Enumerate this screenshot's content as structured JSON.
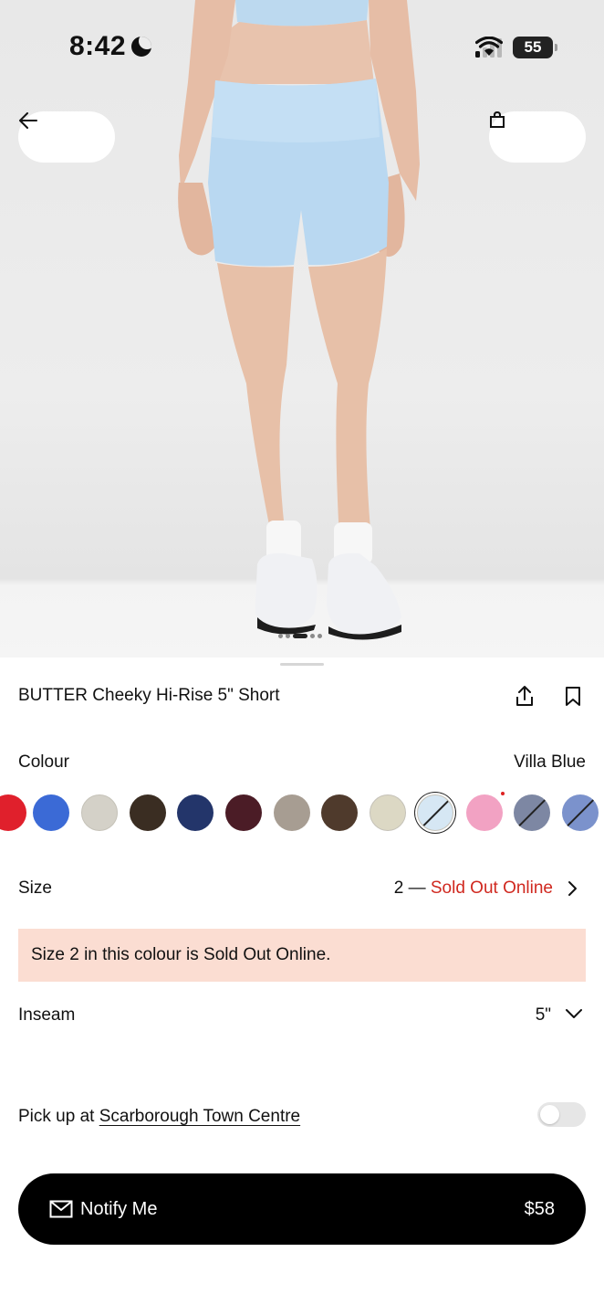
{
  "status_bar": {
    "time": "8:42",
    "battery": "55"
  },
  "product": {
    "title": "BUTTER Cheeky Hi-Rise 5\" Short",
    "colour_label": "Colour",
    "colour_value": "Villa Blue",
    "size_label": "Size",
    "size_value": "2 — ",
    "size_status": "Sold Out Online",
    "alert": "Size  2 in this colour is Sold Out Online.",
    "inseam_label": "Inseam",
    "inseam_value": "5\"",
    "pickup_prefix": "Pick up at ",
    "pickup_store": "Scarborough Town Centre",
    "notify_label": "Notify Me",
    "price": "$58"
  },
  "swatches": [
    {
      "color": "#e0202c",
      "crossed": false,
      "selected": false
    },
    {
      "color": "#3b6ad6",
      "crossed": false,
      "selected": false
    },
    {
      "color": "#d4d1c8",
      "crossed": false,
      "selected": false
    },
    {
      "color": "#3a2d22",
      "crossed": false,
      "selected": false
    },
    {
      "color": "#23356a",
      "crossed": false,
      "selected": false
    },
    {
      "color": "#4b1c26",
      "crossed": false,
      "selected": false
    },
    {
      "color": "#a79d92",
      "crossed": false,
      "selected": false
    },
    {
      "color": "#4f3a2c",
      "crossed": false,
      "selected": false
    },
    {
      "color": "#dcd8c4",
      "crossed": false,
      "selected": false
    },
    {
      "color": "#d6e7f4",
      "crossed": true,
      "selected": true
    },
    {
      "color": "#f2a2c3",
      "crossed": false,
      "selected": false
    },
    {
      "color": "#7d87a3",
      "crossed": true,
      "selected": false
    },
    {
      "color": "#7b92cc",
      "crossed": true,
      "selected": false
    }
  ],
  "image_pager": {
    "count": 5,
    "active_index": 2
  },
  "icons": [
    "moon-icon",
    "signal-icon",
    "wifi-icon",
    "battery-icon",
    "back-arrow-icon",
    "shopping-bag-icon",
    "share-icon",
    "bookmark-icon",
    "chevron-right-icon",
    "chevron-down-icon",
    "mail-icon"
  ]
}
